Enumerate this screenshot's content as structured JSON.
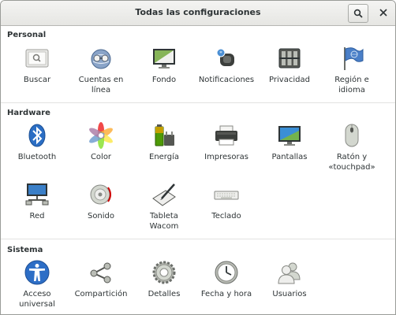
{
  "window": {
    "title": "Todas las configuraciones"
  },
  "sections": {
    "personal": {
      "title": "Personal",
      "items": {
        "buscar": "Buscar",
        "cuentas": "Cuentas en\nlínea",
        "fondo": "Fondo",
        "notificaciones": "Notificaciones",
        "privacidad": "Privacidad",
        "region": "Región e\nidioma"
      }
    },
    "hardware": {
      "title": "Hardware",
      "items": {
        "bluetooth": "Bluetooth",
        "color": "Color",
        "energia": "Energía",
        "impresoras": "Impresoras",
        "pantallas": "Pantallas",
        "raton": "Ratón y\n«touchpad»",
        "red": "Red",
        "sonido": "Sonido",
        "tableta": "Tableta\nWacom",
        "teclado": "Teclado"
      }
    },
    "sistema": {
      "title": "Sistema",
      "items": {
        "acceso": "Acceso\nuniversal",
        "comparticion": "Compartición",
        "detalles": "Detalles",
        "fecha": "Fecha y hora",
        "usuarios": "Usuarios"
      }
    }
  }
}
